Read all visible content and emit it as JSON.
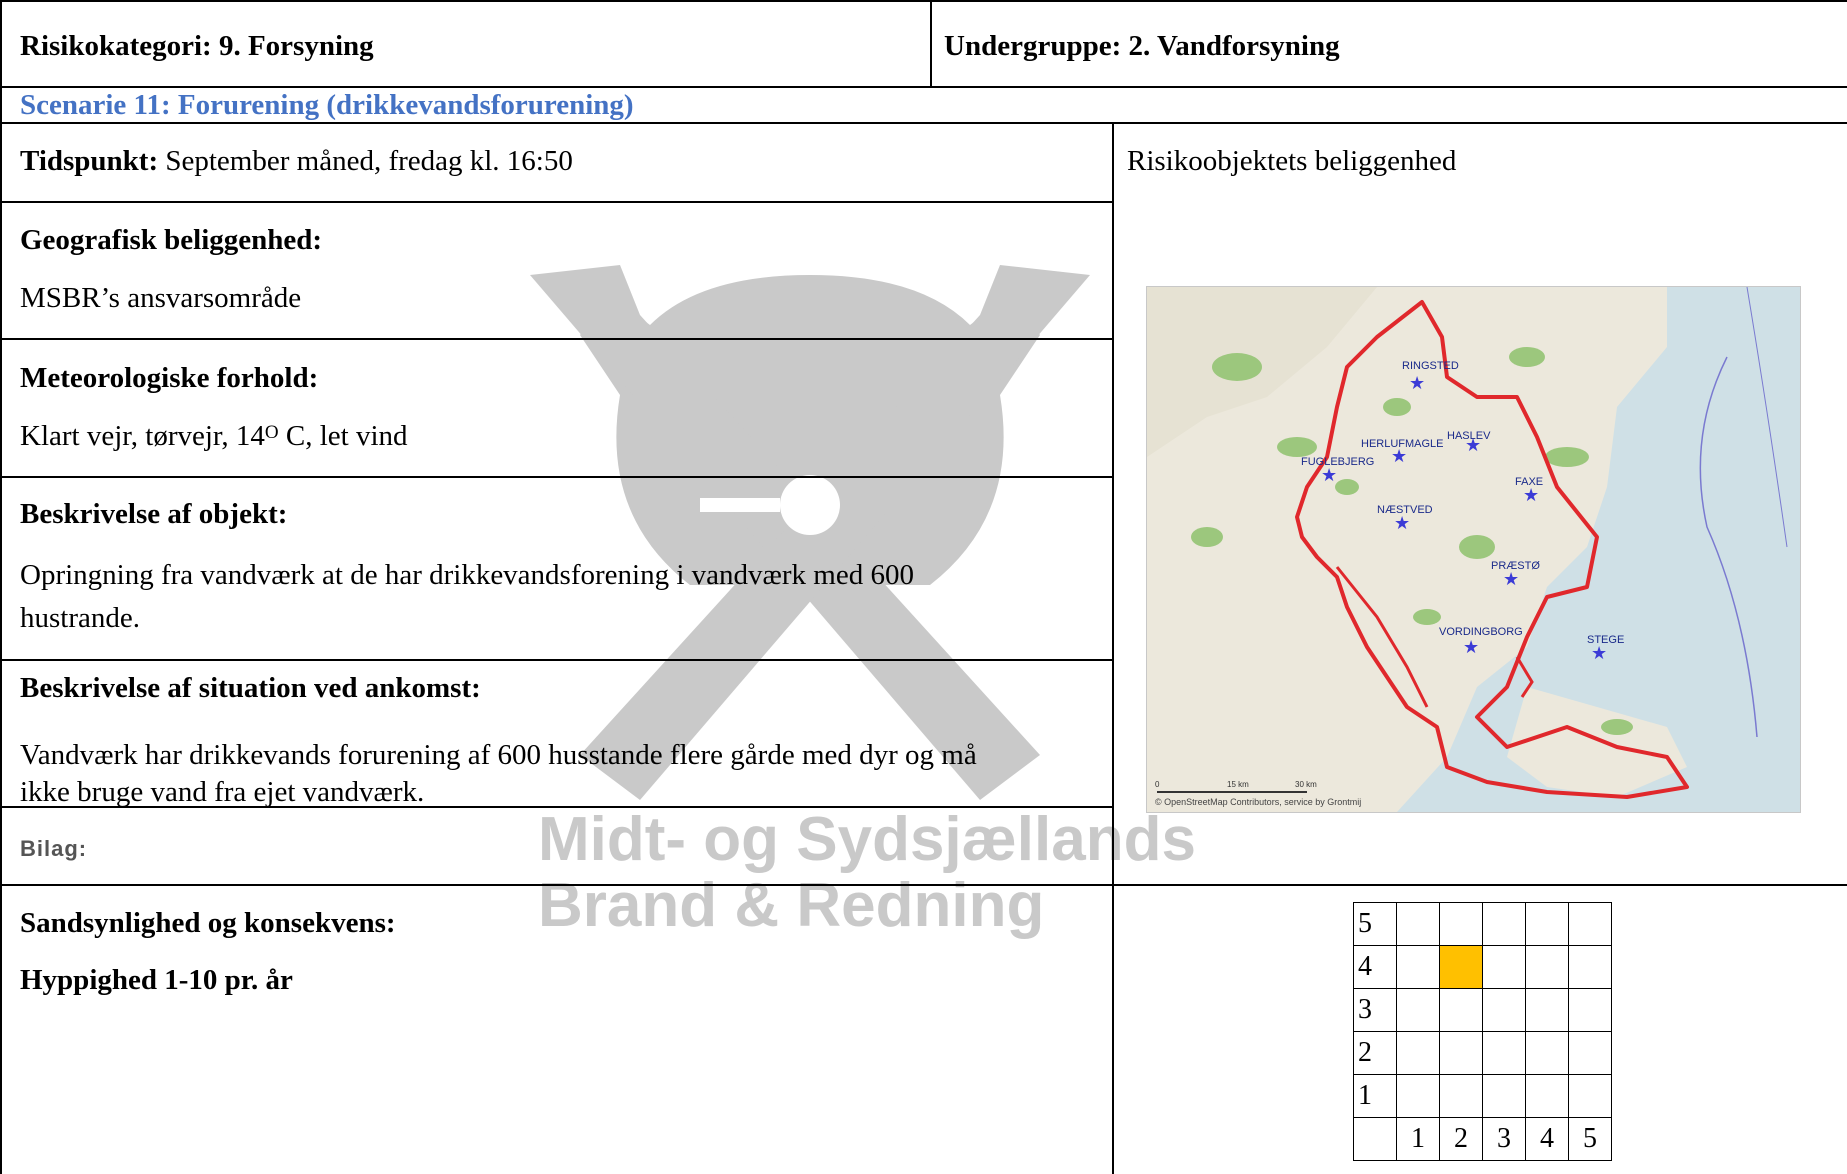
{
  "header": {
    "risk_category": "Risikokategori: 9. Forsyning",
    "subgroup": "Undergruppe: 2. Vandforsyning"
  },
  "scenario": "Scenarie 11: Forurening (drikkevandsforurening)",
  "time": {
    "label": "Tidspunkt:",
    "value": " September måned, fredag kl. 16:50"
  },
  "location_label": "Risikoobjektets beliggenhed",
  "geo": {
    "label": "Geografisk beliggenhed:",
    "value": "MSBR’s ansvarsområde"
  },
  "weather": {
    "label": "Meteorologiske forhold:",
    "value_pre": "Klart vejr, tørvejr, 14",
    "sup": "O",
    "value_post": " C, let vind"
  },
  "object": {
    "label": "Beskrivelse af objekt:",
    "line1": "Opringning fra vandværk at de har drikkevandsforening i vandværk med 600",
    "line2": "hustrande."
  },
  "arrival": {
    "label": "Beskrivelse af situation ved ankomst:",
    "line1": "Vandværk har drikkevands forurening af 600 husstande flere gårde med dyr og må",
    "line2": "ikke bruge vand fra ejet vandværk."
  },
  "attachment_label": "Bilag:",
  "probability": {
    "label": "Sandsynlighed og konsekvens:",
    "frequency": "Hyppighed 1-10 pr. år"
  },
  "watermark": {
    "line1": "Midt- og Sydsjællands",
    "line2": "Brand & Redning"
  },
  "map": {
    "cities": [
      "RINGSTED",
      "HASLEV",
      "HERLUFMAGLE",
      "FUGLEBJERG",
      "FAXE",
      "NÆSTVED",
      "PRÆSTØ",
      "VORDINGBORG",
      "STEGE"
    ],
    "scale_labels": [
      "0",
      "15 km",
      "30 km"
    ],
    "attribution": "© OpenStreetMap Contributors, service by Grontmij",
    "outline_color": "#e0282c",
    "marker_color": "#3b3bd6"
  },
  "risk_matrix": {
    "rows": [
      "5",
      "4",
      "3",
      "2",
      "1"
    ],
    "cols": [
      "1",
      "2",
      "3",
      "4",
      "5"
    ],
    "highlight": {
      "row": "4",
      "col": "2"
    },
    "highlight_color": "#ffc000"
  }
}
